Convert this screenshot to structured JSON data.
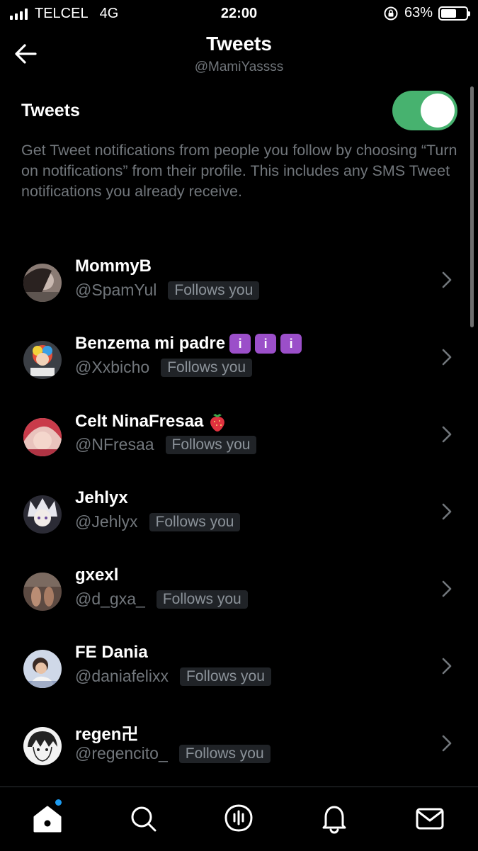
{
  "status_bar": {
    "carrier": "TELCEL",
    "network": "4G",
    "time": "22:00",
    "battery_percent": "63%",
    "battery_level": 0.63,
    "icons": [
      "signal-icon",
      "orientation-lock-icon",
      "battery-icon"
    ]
  },
  "header": {
    "title": "Tweets",
    "subtitle": "@MamiYassss",
    "back_icon": "arrow-left-icon"
  },
  "setting": {
    "label": "Tweets",
    "toggle_on": true,
    "toggle_color": "#47b26f",
    "description": "Get Tweet notifications from people you follow by choosing “Turn on notifications” from their profile. This includes any SMS Tweet notifications you already receive."
  },
  "badge_text": "Follows you",
  "users": [
    {
      "name": "MommyB",
      "handle": "@SpamYul"
    },
    {
      "name": "Benzema mi padre",
      "handle": "@Xxbicho"
    },
    {
      "name": "Celt NinaFresaa",
      "handle": "@NFresaa"
    },
    {
      "name": "Jehlyx",
      "handle": "@Jehlyx"
    },
    {
      "name": "gxexl",
      "handle": "@d_gxa_"
    },
    {
      "name": "FE Dania",
      "handle": "@daniafelixx"
    },
    {
      "name": "regen卍",
      "handle": "@regencito_"
    }
  ],
  "tab_bar": {
    "tabs": [
      "home-icon",
      "search-icon",
      "spaces-icon",
      "notifications-icon",
      "messages-icon"
    ],
    "accent_color": "#1d9bf0"
  }
}
